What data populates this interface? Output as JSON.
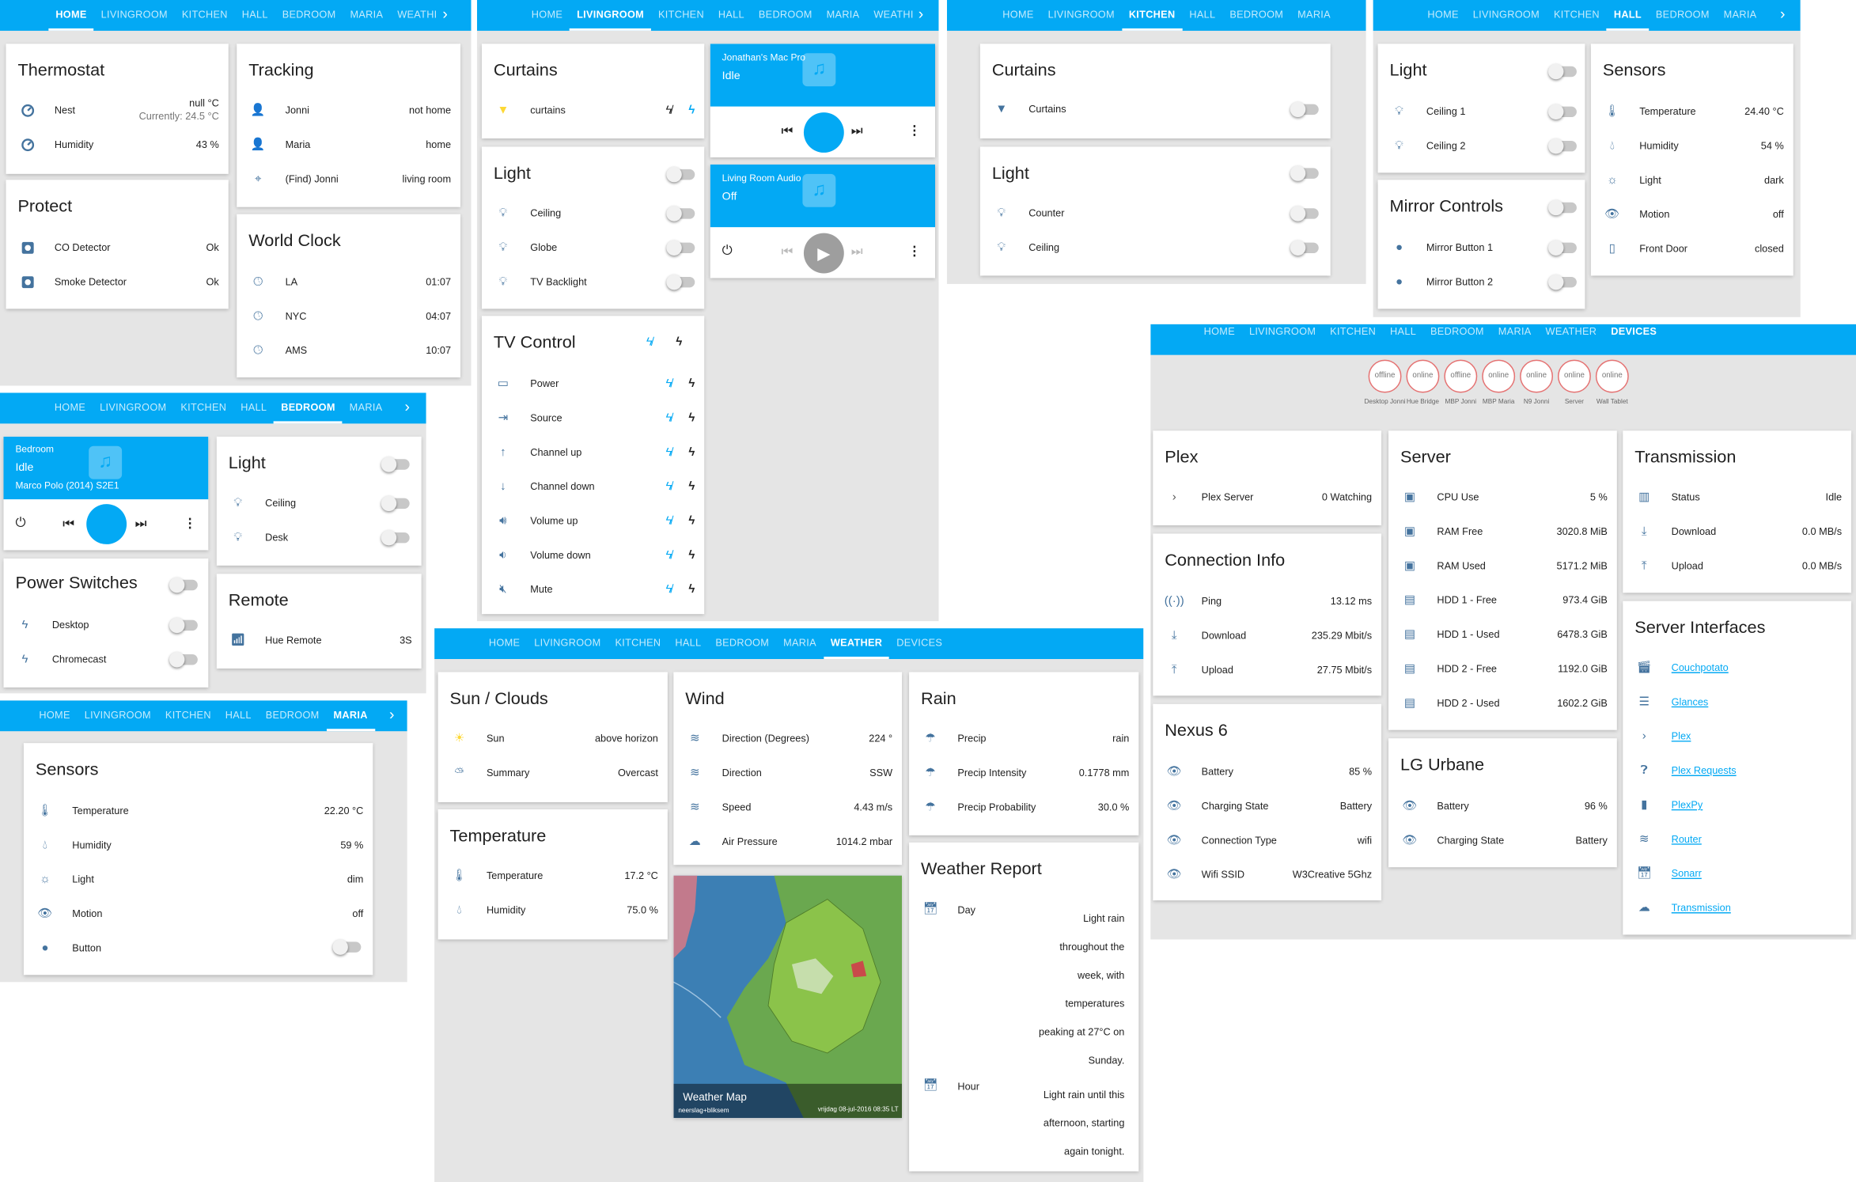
{
  "home": {
    "tabs": [
      "HOME",
      "LIVINGROOM",
      "KITCHEN",
      "HALL",
      "BEDROOM",
      "MARIA",
      "WEATHI"
    ],
    "active": 0,
    "thermostat": {
      "title": "Thermostat",
      "nest": "Nest",
      "nest_val": "null °C",
      "nest_cur": "Currently: 24.5 °C",
      "hum": "Humidity",
      "hum_val": "43 %"
    },
    "protect": {
      "title": "Protect",
      "co": "CO Detector",
      "co_val": "Ok",
      "smoke": "Smoke Detector",
      "smoke_val": "Ok"
    },
    "tracking": {
      "title": "Tracking",
      "rows": [
        {
          "n": "Jonni",
          "v": "not home"
        },
        {
          "n": "Maria",
          "v": "home"
        },
        {
          "n": "(Find) Jonni",
          "v": "living room"
        }
      ]
    },
    "clock": {
      "title": "World Clock",
      "rows": [
        {
          "n": "LA",
          "v": "01:07"
        },
        {
          "n": "NYC",
          "v": "04:07"
        },
        {
          "n": "AMS",
          "v": "10:07"
        }
      ]
    }
  },
  "living": {
    "tabs": [
      "HOME",
      "LIVINGROOM",
      "KITCHEN",
      "HALL",
      "BEDROOM",
      "MARIA",
      "WEATHI"
    ],
    "active": 1,
    "curtains": {
      "title": "Curtains",
      "row": "curtains"
    },
    "light": {
      "title": "Light",
      "rows": [
        "Ceiling",
        "Globe",
        "TV Backlight"
      ]
    },
    "tv": {
      "title": "TV Control",
      "rows": [
        "Power",
        "Source",
        "Channel up",
        "Channel down",
        "Volume up",
        "Volume down",
        "Mute"
      ]
    },
    "mac": {
      "name": "Jonathan's Mac Pro",
      "state": "Idle"
    },
    "audio": {
      "name": "Living Room Audio",
      "state": "Off"
    }
  },
  "kitchen": {
    "tabs": [
      "HOME",
      "LIVINGROOM",
      "KITCHEN",
      "HALL",
      "BEDROOM",
      "MARIA"
    ],
    "active": 2,
    "curtains": {
      "title": "Curtains",
      "row": "Curtains"
    },
    "light": {
      "title": "Light",
      "rows": [
        "Counter",
        "Ceiling"
      ]
    }
  },
  "hall": {
    "tabs": [
      "HOME",
      "LIVINGROOM",
      "KITCHEN",
      "HALL",
      "BEDROOM",
      "MARIA"
    ],
    "active": 3,
    "light": {
      "title": "Light",
      "rows": [
        "Ceiling 1",
        "Ceiling 2"
      ]
    },
    "mirror": {
      "title": "Mirror Controls",
      "rows": [
        "Mirror Button 1",
        "Mirror Button 2"
      ]
    },
    "sensors": {
      "title": "Sensors",
      "rows": [
        {
          "n": "Temperature",
          "v": "24.40 °C"
        },
        {
          "n": "Humidity",
          "v": "54 %"
        },
        {
          "n": "Light",
          "v": "dark"
        },
        {
          "n": "Motion",
          "v": "off"
        },
        {
          "n": "Front Door",
          "v": "closed"
        }
      ]
    }
  },
  "bedroom": {
    "tabs": [
      "HOME",
      "LIVINGROOM",
      "KITCHEN",
      "HALL",
      "BEDROOM",
      "MARIA"
    ],
    "active": 4,
    "media": {
      "name": "Bedroom",
      "state": "Idle",
      "title": "Marco Polo (2014) S2E1"
    },
    "light": {
      "title": "Light",
      "rows": [
        "Ceiling",
        "Desk"
      ]
    },
    "power": {
      "title": "Power Switches",
      "rows": [
        "Desktop",
        "Chromecast"
      ]
    },
    "remote": {
      "title": "Remote",
      "row": "Hue Remote",
      "val": "3S"
    }
  },
  "maria": {
    "tabs": [
      "HOME",
      "LIVINGROOM",
      "KITCHEN",
      "HALL",
      "BEDROOM",
      "MARIA"
    ],
    "active": 5,
    "sensors": {
      "title": "Sensors",
      "rows": [
        {
          "n": "Temperature",
          "v": "22.20 °C"
        },
        {
          "n": "Humidity",
          "v": "59 %"
        },
        {
          "n": "Light",
          "v": "dim"
        },
        {
          "n": "Motion",
          "v": "off"
        },
        {
          "n": "Button",
          "v": ""
        }
      ]
    }
  },
  "weather": {
    "tabs": [
      "HOME",
      "LIVINGROOM",
      "KITCHEN",
      "HALL",
      "BEDROOM",
      "MARIA",
      "WEATHER",
      "DEVICES"
    ],
    "active": 6,
    "sun": {
      "title": "Sun / Clouds",
      "rows": [
        {
          "n": "Sun",
          "v": "above horizon"
        },
        {
          "n": "Summary",
          "v": "Overcast"
        }
      ]
    },
    "temp": {
      "title": "Temperature",
      "rows": [
        {
          "n": "Temperature",
          "v": "17.2 °C"
        },
        {
          "n": "Humidity",
          "v": "75.0 %"
        }
      ]
    },
    "wind": {
      "title": "Wind",
      "rows": [
        {
          "n": "Direction (Degrees)",
          "v": "224 °"
        },
        {
          "n": "Direction",
          "v": "SSW"
        },
        {
          "n": "Speed",
          "v": "4.43 m/s"
        },
        {
          "n": "Air Pressure",
          "v": "1014.2 mbar"
        }
      ]
    },
    "rain": {
      "title": "Rain",
      "rows": [
        {
          "n": "Precip",
          "v": "rain"
        },
        {
          "n": "Precip Intensity",
          "v": "0.1778 mm"
        },
        {
          "n": "Precip Probability",
          "v": "30.0 %"
        }
      ]
    },
    "map": {
      "title": "Weather Map",
      "sub": "neerslag+bliksem",
      "date": "vrijdag 08-jul-2016 08:35 LT"
    },
    "report": {
      "title": "Weather Report",
      "day": "Day",
      "day_lines": [
        "Light rain",
        "throughout the",
        "week, with",
        "temperatures",
        "peaking at 27°C on",
        "Sunday."
      ],
      "hour": "Hour",
      "hour_lines": [
        "Light rain until this",
        "afternoon, starting",
        "again tonight."
      ]
    }
  },
  "devices": {
    "tabs": [
      "HOME",
      "LIVINGROOM",
      "KITCHEN",
      "HALL",
      "BEDROOM",
      "MARIA",
      "WEATHER",
      "DEVICES"
    ],
    "active": 7,
    "badges": [
      {
        "s": "offline",
        "l": "Desktop Jonni"
      },
      {
        "s": "online",
        "l": "Hue Bridge"
      },
      {
        "s": "offline",
        "l": "MBP Jonni"
      },
      {
        "s": "online",
        "l": "MBP Maria"
      },
      {
        "s": "online",
        "l": "N9 Jonni"
      },
      {
        "s": "online",
        "l": "Server"
      },
      {
        "s": "online",
        "l": "Wall Tablet"
      }
    ],
    "plex": {
      "title": "Plex",
      "row": "Plex Server",
      "val": "0 Watching"
    },
    "conn": {
      "title": "Connection Info",
      "rows": [
        {
          "n": "Ping",
          "v": "13.12 ms"
        },
        {
          "n": "Download",
          "v": "235.29 Mbit/s"
        },
        {
          "n": "Upload",
          "v": "27.75 Mbit/s"
        }
      ]
    },
    "nexus": {
      "title": "Nexus 6",
      "rows": [
        {
          "n": "Battery",
          "v": "85 %"
        },
        {
          "n": "Charging State",
          "v": "Battery"
        },
        {
          "n": "Connection Type",
          "v": "wifi"
        },
        {
          "n": "Wifi SSID",
          "v": "W3Creative 5Ghz"
        }
      ]
    },
    "server": {
      "title": "Server",
      "rows": [
        {
          "n": "CPU Use",
          "v": "5 %"
        },
        {
          "n": "RAM Free",
          "v": "3020.8 MiB"
        },
        {
          "n": "RAM Used",
          "v": "5171.2 MiB"
        },
        {
          "n": "HDD 1 - Free",
          "v": "973.4 GiB"
        },
        {
          "n": "HDD 1 - Used",
          "v": "6478.3 GiB"
        },
        {
          "n": "HDD 2 - Free",
          "v": "1192.0 GiB"
        },
        {
          "n": "HDD 2 - Used",
          "v": "1602.2 GiB"
        }
      ]
    },
    "lg": {
      "title": "LG Urbane",
      "rows": [
        {
          "n": "Battery",
          "v": "96 %"
        },
        {
          "n": "Charging State",
          "v": "Battery"
        }
      ]
    },
    "trans": {
      "title": "Transmission",
      "rows": [
        {
          "n": "Status",
          "v": "Idle"
        },
        {
          "n": "Download",
          "v": "0.0 MB/s"
        },
        {
          "n": "Upload",
          "v": "0.0 MB/s"
        }
      ]
    },
    "ifaces": {
      "title": "Server Interfaces",
      "links": [
        "Couchpotato",
        "Glances",
        "Plex",
        "Plex Requests",
        "PlexPy",
        "Router",
        "Sonarr",
        "Transmission"
      ]
    }
  }
}
